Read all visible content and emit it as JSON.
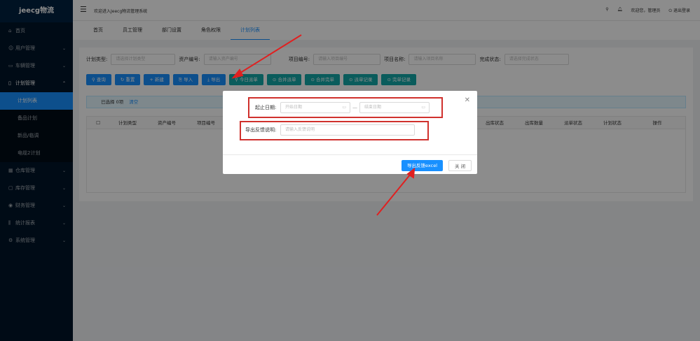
{
  "sidebar": {
    "logo": "jeecg物流",
    "items": [
      {
        "label": "首页",
        "icon": "home-icon"
      },
      {
        "label": "用户管理",
        "icon": "user-icon"
      },
      {
        "label": "车辆管理",
        "icon": "car-icon"
      },
      {
        "label": "计划管理",
        "icon": "file-icon"
      },
      {
        "label": "计划列表"
      },
      {
        "label": "备品计划"
      },
      {
        "label": "新品/临调"
      },
      {
        "label": "电缆2计划"
      },
      {
        "label": "仓库管理",
        "icon": "warehouse-icon"
      },
      {
        "label": "库存管理",
        "icon": "inventory-icon"
      },
      {
        "label": "财务管理",
        "icon": "finance-icon"
      },
      {
        "label": "统计报表",
        "icon": "chart-icon"
      },
      {
        "label": "系统管理",
        "icon": "settings-icon"
      }
    ]
  },
  "header": {
    "welcome": "欢迎进入Jeecg物流管理系统",
    "user": "欢迎您，管理员",
    "logout": "退出登录"
  },
  "tabs": [
    "首页",
    "员工管理",
    "部门设置",
    "角色权限",
    "计划列表"
  ],
  "filters": {
    "plan_type_label": "计划类型:",
    "plan_type_ph": "请选择计划类型",
    "asset_label": "资产编号:",
    "asset_ph": "请输入资产编号",
    "proj_no_label": "项目编号:",
    "proj_no_ph": "请输入项目编号",
    "proj_name_label": "项目名称:",
    "proj_name_ph": "请输入项目名称",
    "status_label": "完成状态:",
    "status_ph": "请选择完成状态"
  },
  "buttons": [
    "查询",
    "重置",
    "新建",
    "导入",
    "导出",
    "今日派单",
    "合并派单",
    "合并完单",
    "派单记录",
    "完单记录"
  ],
  "selection": {
    "text": "已选择 0项",
    "clear": "清空"
  },
  "table": {
    "columns_left": [
      "计划类型",
      "资产编号",
      "项目编号"
    ],
    "columns_right": [
      "出库状态",
      "出库数量",
      "派单状态",
      "计划状态",
      "操作"
    ]
  },
  "modal": {
    "date_label": "起止日期:",
    "start_ph": "开始日期",
    "end_ph": "结束日期",
    "desc_label": "导出反馈说明:",
    "desc_ph": "请输入反馈说明",
    "export_btn": "导出反馈excel",
    "close_btn": "关 闭"
  }
}
